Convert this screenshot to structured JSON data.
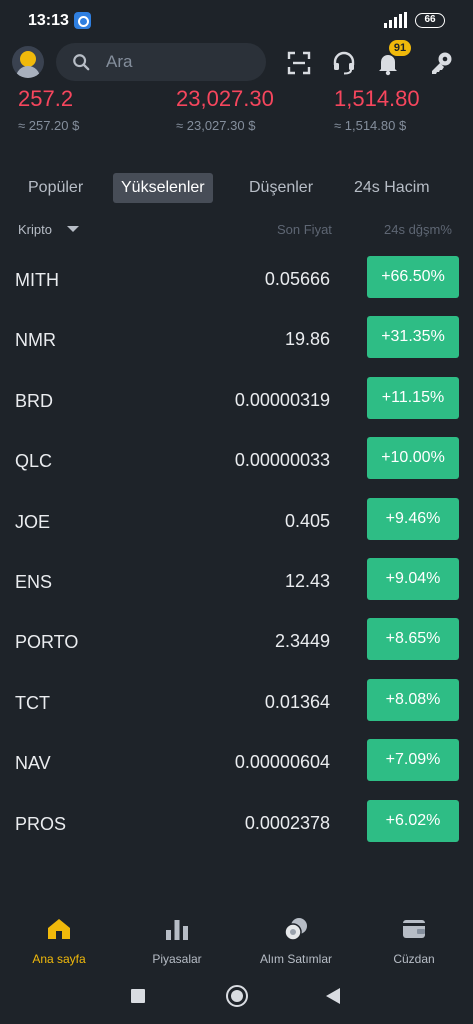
{
  "status_bar": {
    "time": "13:13",
    "battery": "66"
  },
  "header": {
    "search_placeholder": "Ara",
    "notification_count": "91"
  },
  "tickers": [
    {
      "price": "257.2",
      "fiat": "≈ 257.20 $"
    },
    {
      "price": "23,027.30",
      "fiat": "≈ 23,027.30 $"
    },
    {
      "price": "1,514.80",
      "fiat": "≈ 1,514.80 $"
    }
  ],
  "tabs": [
    {
      "label": "Popüler",
      "active": false
    },
    {
      "label": "Yükselenler",
      "active": true
    },
    {
      "label": "Düşenler",
      "active": false
    },
    {
      "label": "24s Hacim",
      "active": false
    }
  ],
  "columns": {
    "crypto": "Kripto",
    "last_price": "Son Fiyat",
    "change": "24s dğşm%"
  },
  "rows": [
    {
      "symbol": "MITH",
      "price": "0.05666",
      "change": "+66.50%"
    },
    {
      "symbol": "NMR",
      "price": "19.86",
      "change": "+31.35%"
    },
    {
      "symbol": "BRD",
      "price": "0.00000319",
      "change": "+11.15%"
    },
    {
      "symbol": "QLC",
      "price": "0.00000033",
      "change": "+10.00%"
    },
    {
      "symbol": "JOE",
      "price": "0.405",
      "change": "+9.46%"
    },
    {
      "symbol": "ENS",
      "price": "12.43",
      "change": "+9.04%"
    },
    {
      "symbol": "PORTO",
      "price": "2.3449",
      "change": "+8.65%"
    },
    {
      "symbol": "TCT",
      "price": "0.01364",
      "change": "+8.08%"
    },
    {
      "symbol": "NAV",
      "price": "0.00000604",
      "change": "+7.09%"
    },
    {
      "symbol": "PROS",
      "price": "0.0002378",
      "change": "+6.02%"
    }
  ],
  "bottom_nav": [
    {
      "label": "Ana sayfa",
      "icon": "home-icon",
      "active": true
    },
    {
      "label": "Piyasalar",
      "icon": "markets-icon",
      "active": false
    },
    {
      "label": "Alım Satımlar",
      "icon": "trade-icon",
      "active": false
    },
    {
      "label": "Cüzdan",
      "icon": "wallet-icon",
      "active": false
    }
  ],
  "colors": {
    "background": "#1e2329",
    "accent": "#f0b90b",
    "up": "#2ebd85",
    "down": "#f6465d"
  }
}
